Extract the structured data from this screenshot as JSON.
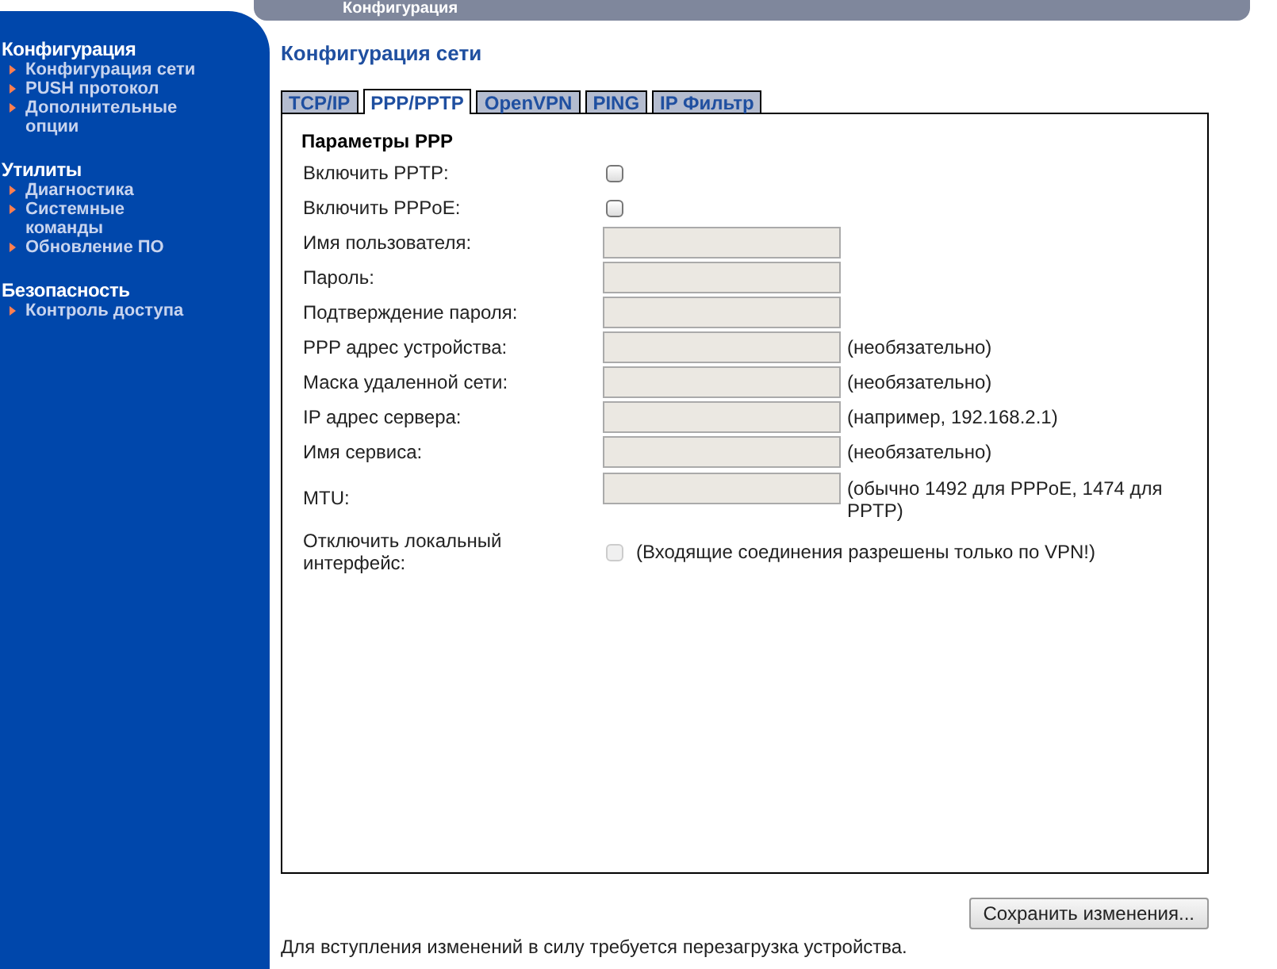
{
  "header": {
    "title": "Конфигурация"
  },
  "sidebar": {
    "sections": [
      {
        "title": "Конфигурация",
        "items": [
          {
            "label": "Конфигурация сети"
          },
          {
            "label": "PUSH протокол"
          },
          {
            "label": "Дополнительные опции"
          }
        ]
      },
      {
        "title": "Утилиты",
        "items": [
          {
            "label": "Диагностика"
          },
          {
            "label": "Системные команды"
          },
          {
            "label": "Обновление ПО"
          }
        ]
      },
      {
        "title": "Безопасность",
        "items": [
          {
            "label": "Контроль доступа"
          }
        ]
      }
    ]
  },
  "page_title": "Конфигурация сети",
  "tabs": [
    {
      "label": "TCP/IP",
      "selected": false
    },
    {
      "label": "PPP/PPTP",
      "selected": true
    },
    {
      "label": "OpenVPN",
      "selected": false
    },
    {
      "label": "PING",
      "selected": false
    },
    {
      "label": "IP Фильтр",
      "selected": false
    }
  ],
  "section_title": "Параметры PPP",
  "fields": [
    {
      "kind": "checkbox",
      "label": "Включить PPTP:",
      "checked": false,
      "disabled": false
    },
    {
      "kind": "checkbox",
      "label": "Включить PPPoE:",
      "checked": false,
      "disabled": false
    },
    {
      "kind": "text",
      "label": "Имя пользователя:",
      "disabled": true
    },
    {
      "kind": "text",
      "label": "Пароль:",
      "disabled": true
    },
    {
      "kind": "text",
      "label": "Подтверждение пароля:",
      "disabled": true
    },
    {
      "kind": "text",
      "label": "PPP адрес устройства:",
      "disabled": true,
      "note": "(необязательно)"
    },
    {
      "kind": "text",
      "label": "Маска удаленной сети:",
      "disabled": true,
      "note": "(необязательно)"
    },
    {
      "kind": "text",
      "label": "IP адрес сервера:",
      "disabled": true,
      "note": "(например, 192.168.2.1)"
    },
    {
      "kind": "text",
      "label": "Имя сервиса:",
      "disabled": true,
      "note": "(необязательно)"
    },
    {
      "kind": "text",
      "label": "MTU:",
      "disabled": true,
      "note": "(обычно 1492 для PPPoE, 1474 для PPTP)"
    },
    {
      "kind": "checkbox",
      "label": "Отключить локальный интерфейс:",
      "checked": false,
      "disabled": true,
      "note": "(Входящие соединения разрешены только по VPN!)"
    }
  ],
  "save_button": "Сохранить изменения...",
  "footer_note": "Для вступления изменений в силу требуется перезагрузка устройства."
}
